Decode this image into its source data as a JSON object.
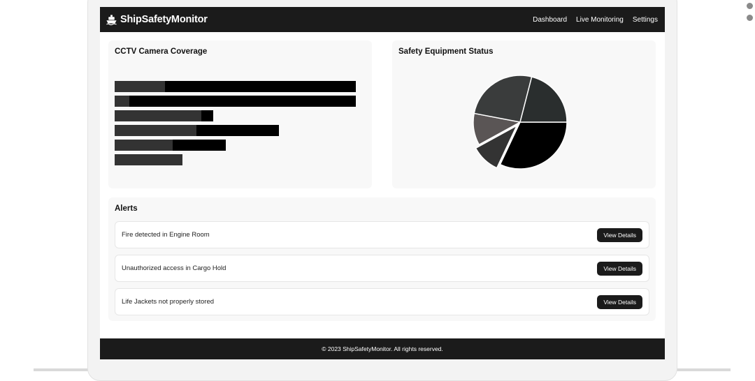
{
  "app": {
    "brand_name": "ShipSafetyMonitor",
    "brand_icon": "ship-icon"
  },
  "nav": {
    "links": [
      "Dashboard",
      "Live Monitoring",
      "Settings"
    ]
  },
  "cctv": {
    "title": "CCTV Camera Coverage"
  },
  "safety": {
    "title": "Safety Equipment Status"
  },
  "alerts": {
    "title": "Alerts",
    "items": [
      {
        "text": "Fire detected in Engine Room",
        "button": "View Details"
      },
      {
        "text": "Unauthorized access in Cargo Hold",
        "button": "View Details"
      },
      {
        "text": "Life Jackets not properly stored",
        "button": "View Details"
      }
    ]
  },
  "footer": {
    "text": "© 2023 ShipSafetyMonitor. All rights reserved."
  },
  "chart_data": [
    {
      "type": "bar",
      "orientation": "horizontal",
      "stacked": true,
      "title": "CCTV Camera Coverage",
      "xlim": [
        0,
        100
      ],
      "colors": [
        "#333333",
        "#000000"
      ],
      "series": [
        {
          "values": [
            21,
            6,
            36,
            34,
            24,
            28
          ]
        },
        {
          "values": [
            79,
            94,
            5,
            34,
            22,
            0
          ]
        }
      ]
    },
    {
      "type": "pie",
      "title": "Safety Equipment Status",
      "exploded_slice": 1,
      "slices": [
        {
          "value": 32,
          "color": "#000000"
        },
        {
          "value": 10,
          "color": "#333333"
        },
        {
          "value": 11,
          "color": "#5a5555"
        },
        {
          "value": 26,
          "color": "#3a3c3c"
        },
        {
          "value": 21,
          "color": "#2a2e2e"
        }
      ]
    }
  ]
}
